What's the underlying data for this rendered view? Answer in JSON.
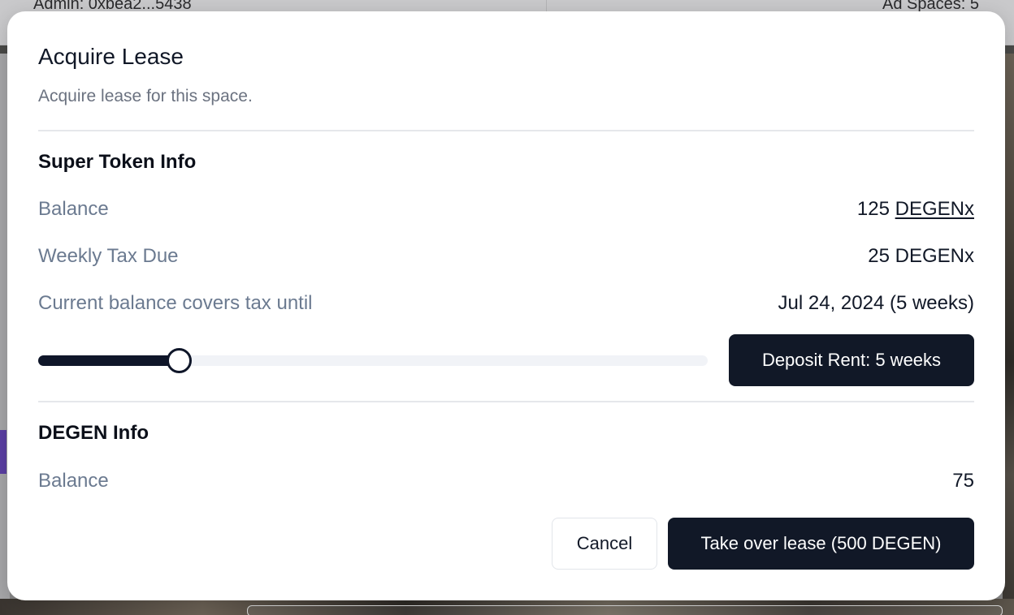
{
  "background": {
    "admin_text": "Admin: 0xbea2...5438",
    "ad_spaces_text": "Ad Spaces: 5"
  },
  "modal": {
    "title": "Acquire Lease",
    "subtitle": "Acquire lease for this space.",
    "super_token": {
      "heading": "Super Token Info",
      "balance_label": "Balance",
      "balance_amount": "125",
      "balance_token": "DEGENx",
      "weekly_tax_label": "Weekly Tax Due",
      "weekly_tax_value": "25 DEGENx",
      "covers_label": "Current balance covers tax until",
      "covers_value": "Jul 24, 2024 (5 weeks)"
    },
    "slider": {
      "value_fraction": 0.211
    },
    "deposit_button": "Deposit Rent: 5 weeks",
    "degen": {
      "heading": "DEGEN Info",
      "balance_label": "Balance",
      "balance_value": "75"
    },
    "cancel_button": "Cancel",
    "takeover_button": "Take over lease (500 DEGEN)"
  }
}
